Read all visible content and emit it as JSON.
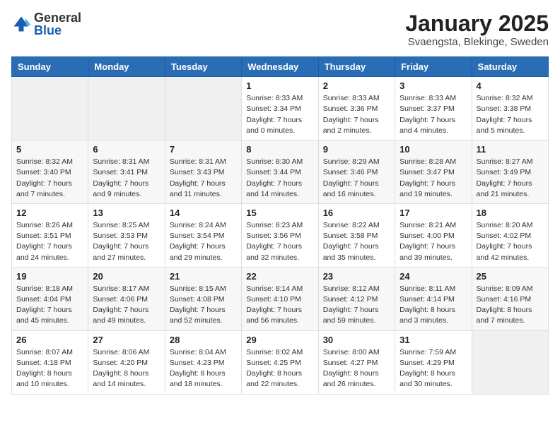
{
  "header": {
    "logo_general": "General",
    "logo_blue": "Blue",
    "title": "January 2025",
    "subtitle": "Svaengsta, Blekinge, Sweden"
  },
  "weekdays": [
    "Sunday",
    "Monday",
    "Tuesday",
    "Wednesday",
    "Thursday",
    "Friday",
    "Saturday"
  ],
  "weeks": [
    [
      {
        "day": "",
        "info": ""
      },
      {
        "day": "",
        "info": ""
      },
      {
        "day": "",
        "info": ""
      },
      {
        "day": "1",
        "info": "Sunrise: 8:33 AM\nSunset: 3:34 PM\nDaylight: 7 hours\nand 0 minutes."
      },
      {
        "day": "2",
        "info": "Sunrise: 8:33 AM\nSunset: 3:36 PM\nDaylight: 7 hours\nand 2 minutes."
      },
      {
        "day": "3",
        "info": "Sunrise: 8:33 AM\nSunset: 3:37 PM\nDaylight: 7 hours\nand 4 minutes."
      },
      {
        "day": "4",
        "info": "Sunrise: 8:32 AM\nSunset: 3:38 PM\nDaylight: 7 hours\nand 5 minutes."
      }
    ],
    [
      {
        "day": "5",
        "info": "Sunrise: 8:32 AM\nSunset: 3:40 PM\nDaylight: 7 hours\nand 7 minutes."
      },
      {
        "day": "6",
        "info": "Sunrise: 8:31 AM\nSunset: 3:41 PM\nDaylight: 7 hours\nand 9 minutes."
      },
      {
        "day": "7",
        "info": "Sunrise: 8:31 AM\nSunset: 3:43 PM\nDaylight: 7 hours\nand 11 minutes."
      },
      {
        "day": "8",
        "info": "Sunrise: 8:30 AM\nSunset: 3:44 PM\nDaylight: 7 hours\nand 14 minutes."
      },
      {
        "day": "9",
        "info": "Sunrise: 8:29 AM\nSunset: 3:46 PM\nDaylight: 7 hours\nand 16 minutes."
      },
      {
        "day": "10",
        "info": "Sunrise: 8:28 AM\nSunset: 3:47 PM\nDaylight: 7 hours\nand 19 minutes."
      },
      {
        "day": "11",
        "info": "Sunrise: 8:27 AM\nSunset: 3:49 PM\nDaylight: 7 hours\nand 21 minutes."
      }
    ],
    [
      {
        "day": "12",
        "info": "Sunrise: 8:26 AM\nSunset: 3:51 PM\nDaylight: 7 hours\nand 24 minutes."
      },
      {
        "day": "13",
        "info": "Sunrise: 8:25 AM\nSunset: 3:53 PM\nDaylight: 7 hours\nand 27 minutes."
      },
      {
        "day": "14",
        "info": "Sunrise: 8:24 AM\nSunset: 3:54 PM\nDaylight: 7 hours\nand 29 minutes."
      },
      {
        "day": "15",
        "info": "Sunrise: 8:23 AM\nSunset: 3:56 PM\nDaylight: 7 hours\nand 32 minutes."
      },
      {
        "day": "16",
        "info": "Sunrise: 8:22 AM\nSunset: 3:58 PM\nDaylight: 7 hours\nand 35 minutes."
      },
      {
        "day": "17",
        "info": "Sunrise: 8:21 AM\nSunset: 4:00 PM\nDaylight: 7 hours\nand 39 minutes."
      },
      {
        "day": "18",
        "info": "Sunrise: 8:20 AM\nSunset: 4:02 PM\nDaylight: 7 hours\nand 42 minutes."
      }
    ],
    [
      {
        "day": "19",
        "info": "Sunrise: 8:18 AM\nSunset: 4:04 PM\nDaylight: 7 hours\nand 45 minutes."
      },
      {
        "day": "20",
        "info": "Sunrise: 8:17 AM\nSunset: 4:06 PM\nDaylight: 7 hours\nand 49 minutes."
      },
      {
        "day": "21",
        "info": "Sunrise: 8:15 AM\nSunset: 4:08 PM\nDaylight: 7 hours\nand 52 minutes."
      },
      {
        "day": "22",
        "info": "Sunrise: 8:14 AM\nSunset: 4:10 PM\nDaylight: 7 hours\nand 56 minutes."
      },
      {
        "day": "23",
        "info": "Sunrise: 8:12 AM\nSunset: 4:12 PM\nDaylight: 7 hours\nand 59 minutes."
      },
      {
        "day": "24",
        "info": "Sunrise: 8:11 AM\nSunset: 4:14 PM\nDaylight: 8 hours\nand 3 minutes."
      },
      {
        "day": "25",
        "info": "Sunrise: 8:09 AM\nSunset: 4:16 PM\nDaylight: 8 hours\nand 7 minutes."
      }
    ],
    [
      {
        "day": "26",
        "info": "Sunrise: 8:07 AM\nSunset: 4:18 PM\nDaylight: 8 hours\nand 10 minutes."
      },
      {
        "day": "27",
        "info": "Sunrise: 8:06 AM\nSunset: 4:20 PM\nDaylight: 8 hours\nand 14 minutes."
      },
      {
        "day": "28",
        "info": "Sunrise: 8:04 AM\nSunset: 4:23 PM\nDaylight: 8 hours\nand 18 minutes."
      },
      {
        "day": "29",
        "info": "Sunrise: 8:02 AM\nSunset: 4:25 PM\nDaylight: 8 hours\nand 22 minutes."
      },
      {
        "day": "30",
        "info": "Sunrise: 8:00 AM\nSunset: 4:27 PM\nDaylight: 8 hours\nand 26 minutes."
      },
      {
        "day": "31",
        "info": "Sunrise: 7:59 AM\nSunset: 4:29 PM\nDaylight: 8 hours\nand 30 minutes."
      },
      {
        "day": "",
        "info": ""
      }
    ]
  ]
}
